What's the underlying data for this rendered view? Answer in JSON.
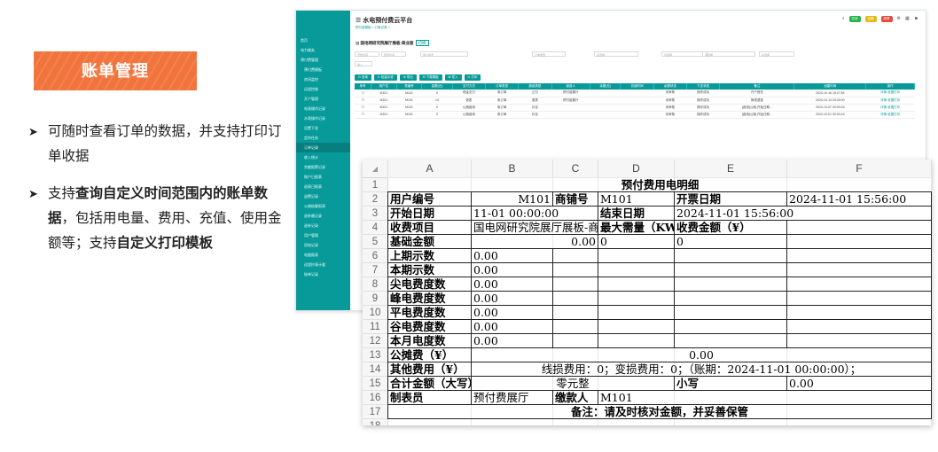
{
  "intro": {
    "badge": "账单管理",
    "bullet1": {
      "text": "可随时查看订单的数据，并支持打印订单收据"
    },
    "bullet2": {
      "p1": "支持",
      "b1": "查询自定义时间范围内的账单数据",
      "p2": "，包括用电量、费用、充值、使用金额等；支持",
      "b2": "自定义打印模板"
    }
  },
  "app": {
    "title": "水电预付费云平台",
    "tabs": "预付费模板  × 订单记录 ×",
    "org": "国电网研究院展厅展板-商业版",
    "org_tag": "切换",
    "buttons": [
      "⊡ 查询",
      "↻ 批量补收",
      "⊕ 导出",
      "⊟ 下载模板",
      "⊞ 导入",
      "⊙ 打印"
    ],
    "filters": [
      "开始时间",
      "结束时间",
      "用户编号",
      "订单类型",
      "请选择",
      "请选择",
      "请选择",
      "请选择",
      "输入"
    ],
    "sidebar": [
      "首页",
      "电力服务",
      "预付费管理",
      "预付费模板",
      "房间监控",
      "远程控制",
      "开户管理",
      "电表操作记录",
      "水表操作记录",
      "设置下发",
      "定时任务",
      "订单记录",
      "收入统计",
      "余额报警记录",
      "账户日报表",
      "退表日报表",
      "退费记录",
      "公摊结算报表",
      "退补缴记录",
      "退补记录",
      "用户管理",
      "用电记录",
      "电量报表",
      "远程抄表计量",
      "账单记录"
    ],
    "columns": [
      "序号",
      "用户名",
      "表编号",
      "金额(元)",
      "支付方式",
      "订单类型",
      "缴费类型",
      "缴费人",
      "余额(元)",
      "充值时间",
      "余额状态",
      "下发状态",
      "备注",
      "创建时间",
      "操作"
    ],
    "rows": [
      [
        "M101",
        "M101",
        "0",
        "现金支付",
        "电订单",
        "云付",
        "预付费展厅",
        "",
        "",
        "未审核",
        "操作成功",
        "开户首充",
        "2024-10-16 15:27:54",
        "详情 收据打印"
      ],
      [
        "M101",
        "M101",
        "10",
        "退表",
        "电订单",
        "退表",
        "预付费展厅",
        "",
        "",
        "未审核",
        "操作成功",
        "换表退费",
        "2024-10-14 09:30:00",
        "详情 收据打印"
      ],
      [
        "M101",
        "M101",
        "0",
        "公摊费用",
        "电订单",
        "补足",
        "",
        "",
        "",
        "未审核",
        "操作成功",
        "[费用]公摊,开始日期...",
        "2024-10-07 00:00:24",
        "详情 收据打印"
      ],
      [
        "M101",
        "M101",
        "0",
        "公摊费用",
        "电订单",
        "补足",
        "",
        "",
        "",
        "未审核",
        "操作成功",
        "[费用]公摊,开始日期...",
        "2024-10-01 00:00:24",
        "详情 收据打印"
      ]
    ]
  },
  "sheet": {
    "col_letters": [
      "A",
      "B",
      "C",
      "D",
      "E",
      "F"
    ],
    "row_numbers": [
      "1",
      "2",
      "3",
      "4",
      "5",
      "6",
      "7",
      "8",
      "9",
      "10",
      "11",
      "12",
      "13",
      "14",
      "15",
      "16",
      "17",
      "18"
    ],
    "title": "预付费用电明细",
    "user_no_label": "用户编号",
    "user_no": "M101",
    "shop_no_label": "商铺号",
    "shop_no": "M101",
    "invoice_date_label": "开票日期",
    "invoice_date": "2024-11-01 15:56:00",
    "start_label": "开始日期",
    "start_value": "11-01 00:00:00",
    "end_label": "结束日期",
    "end_value": "2024-11-01 15:56:00",
    "item_label": "收费项目",
    "item_value": "国电网研究院展厅展板-商业版",
    "max_demand_label": "最大需量（KW）",
    "collect_label": "收费金额（¥）",
    "base_label": "基础金额",
    "base_value": "0.00",
    "base_d": "0",
    "base_e": "0",
    "meter_rows": [
      {
        "label": "上期示数",
        "value": "0.00"
      },
      {
        "label": "本期示数",
        "value": "0.00"
      },
      {
        "label": "尖电费度数",
        "value": "0.00"
      },
      {
        "label": "峰电费度数",
        "value": "0.00"
      },
      {
        "label": "平电费度数",
        "value": "0.00"
      },
      {
        "label": "谷电费度数",
        "value": "0.00"
      },
      {
        "label": "本月电度数",
        "value": "0.00"
      }
    ],
    "shared_label": "公摊费（¥）",
    "shared_value": "0.00",
    "other_label": "其他费用（¥）",
    "other_value": "线损费用：0；变损费用：0；（账期：2024-11-01 00:00:00）；",
    "total_cn_label": "合计金额（大写）",
    "total_cn_value": "零元整",
    "small_label": "小写",
    "small_value": "0.00",
    "maker_label": "制表员",
    "maker_value": "预付费展厅",
    "payer_label": "缴款人",
    "payer_value": "M101",
    "note": "备注：请及时核对金额，并妥善保管"
  }
}
